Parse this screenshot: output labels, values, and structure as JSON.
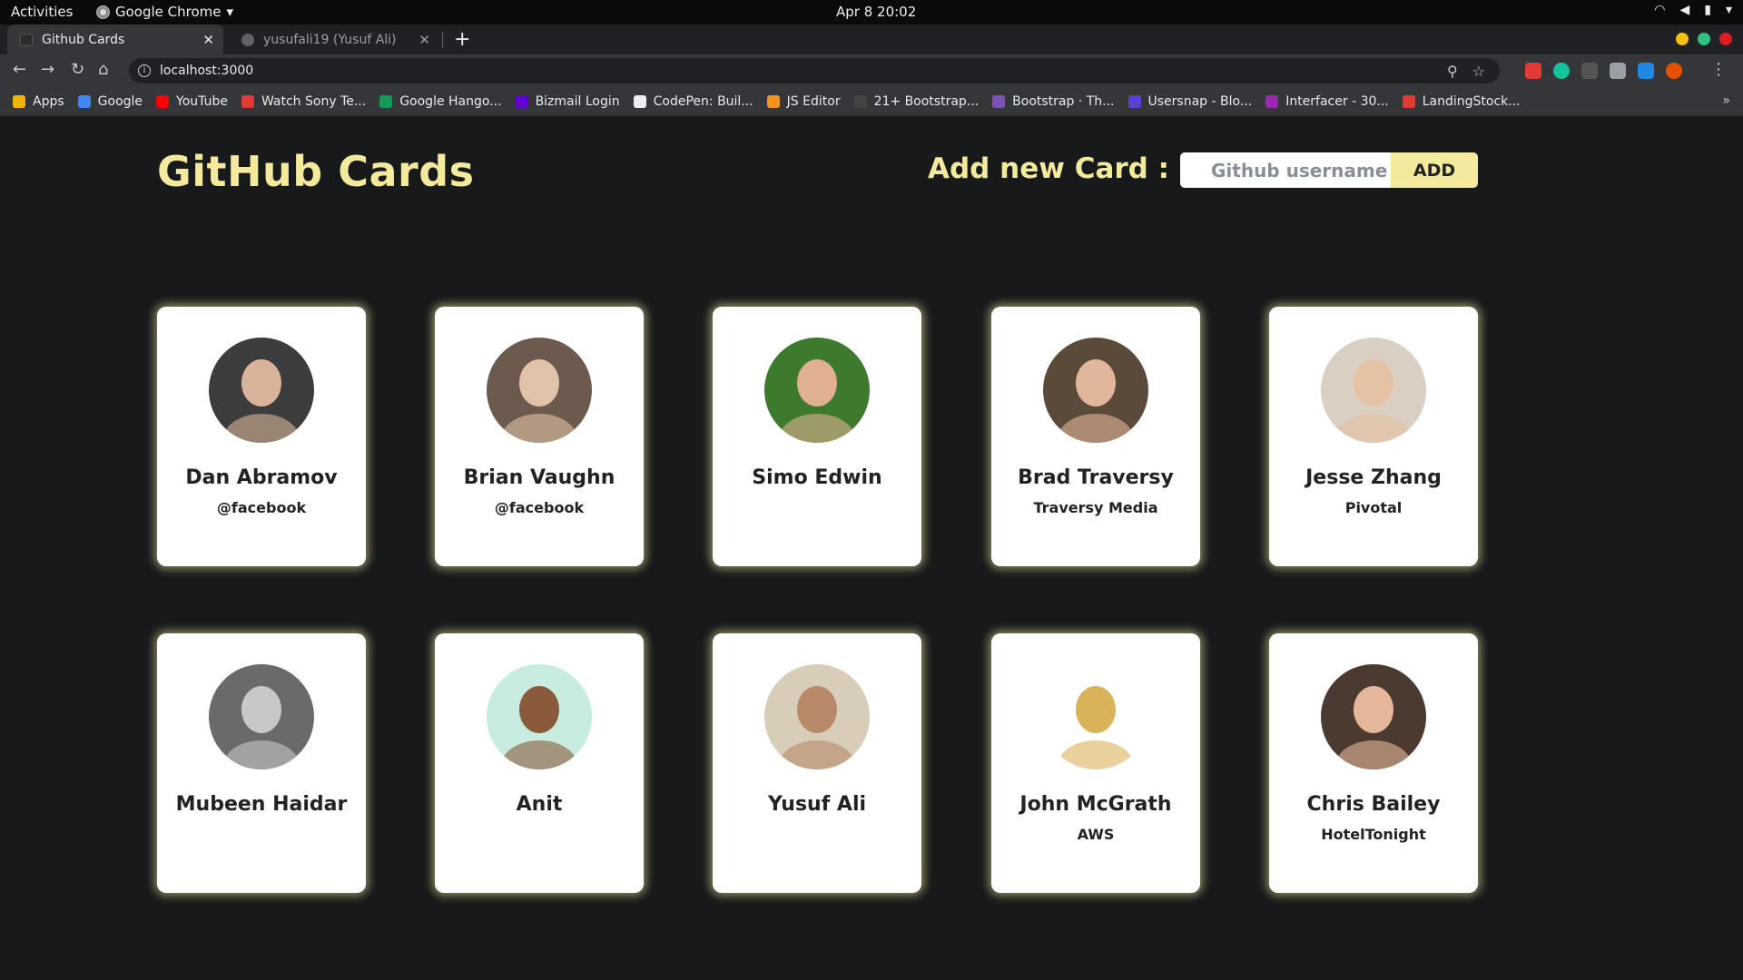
{
  "os": {
    "activities": "Activities",
    "app_name": "Google Chrome",
    "app_menu_icon": "chevron-down-icon",
    "clock": "Apr 8  20:02"
  },
  "browser": {
    "tabs": [
      {
        "title": "Github Cards",
        "active": true
      },
      {
        "title": "yusufali19 (Yusuf Ali)",
        "active": false
      }
    ],
    "url": "localhost:3000",
    "bookmarks": [
      {
        "label": "Apps",
        "color": "#f4b400"
      },
      {
        "label": "Google",
        "color": "#4285f4"
      },
      {
        "label": "YouTube",
        "color": "#ff0000"
      },
      {
        "label": "Watch Sony Te...",
        "color": "#e53935"
      },
      {
        "label": "Google Hango...",
        "color": "#0f9d58"
      },
      {
        "label": "Bizmail Login",
        "color": "#6001d2"
      },
      {
        "label": "CodePen: Buil...",
        "color": "#eeeeee"
      },
      {
        "label": "JS Editor",
        "color": "#f7931e"
      },
      {
        "label": "21+ Bootstrap...",
        "color": "#444444"
      },
      {
        "label": "Bootstrap · Th...",
        "color": "#7952b3"
      },
      {
        "label": "Usersnap - Blo...",
        "color": "#5b3fd6"
      },
      {
        "label": "Interfacer - 30...",
        "color": "#9c27b0"
      },
      {
        "label": "LandingStock...",
        "color": "#e53935"
      }
    ]
  },
  "header": {
    "title": "GitHub Cards",
    "add_label": "Add new Card :",
    "input_placeholder": "Github username",
    "add_button": "ADD"
  },
  "cards": [
    {
      "name": "Dan Abramov",
      "company": "@facebook",
      "avatar_bg": "#3c3c3c",
      "avatar_fg": "#d9b49a"
    },
    {
      "name": "Brian Vaughn",
      "company": "@facebook",
      "avatar_bg": "#6b5a4d",
      "avatar_fg": "#e0c3a8"
    },
    {
      "name": "Simo Edwin",
      "company": "",
      "avatar_bg": "#3d7a2e",
      "avatar_fg": "#e0b090"
    },
    {
      "name": "Brad Traversy",
      "company": "Traversy Media",
      "avatar_bg": "#5a4a3a",
      "avatar_fg": "#e2b69a"
    },
    {
      "name": "Jesse Zhang",
      "company": "Pivotal",
      "avatar_bg": "#d9cfc2",
      "avatar_fg": "#e6c2a4"
    },
    {
      "name": "Mubeen Haidar",
      "company": "",
      "avatar_bg": "#6a6a6a",
      "avatar_fg": "#c8c8c8"
    },
    {
      "name": "Anit",
      "company": "",
      "avatar_bg": "#c9ece0",
      "avatar_fg": "#8a5a3a"
    },
    {
      "name": "Yusuf Ali",
      "company": "",
      "avatar_bg": "#d8cdb8",
      "avatar_fg": "#b88a6a"
    },
    {
      "name": "John McGrath",
      "company": "AWS",
      "avatar_bg": "#ffffff",
      "avatar_fg": "#d9b35a"
    },
    {
      "name": "Chris Bailey",
      "company": "HotelTonight",
      "avatar_bg": "#4a3a30",
      "avatar_fg": "#e6b89a"
    }
  ],
  "colors": {
    "accent": "#f3ea9e",
    "page_bg": "#17191a",
    "card_bg": "#ffffff"
  }
}
